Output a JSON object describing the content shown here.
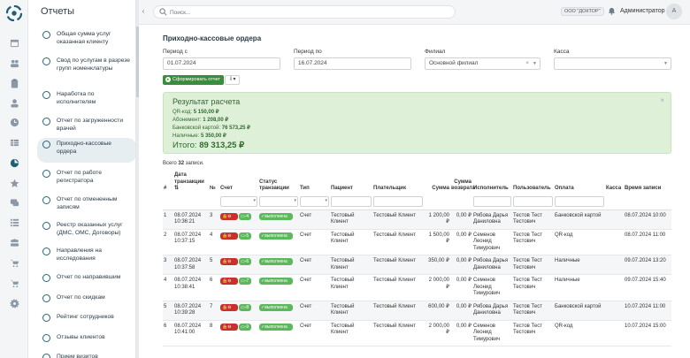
{
  "sidebar": {
    "title": "Отчеты",
    "items": [
      {
        "label": "Общая сумма услуг оказанная клиенту"
      },
      {
        "label": "Свод по услугам в разрезе групп номенклатуры"
      },
      {
        "label": "Наработка по исполнителям"
      },
      {
        "label": "Отчет по загруженности врачей"
      },
      {
        "label": "Приходно-кассовые ордера",
        "active": true
      },
      {
        "label": "Отчет по работе регистратора"
      },
      {
        "label": "Отчет по отмененным записям"
      },
      {
        "label": "Реестр оказанных услуг (ДМС, ОМС, Договоры)"
      },
      {
        "label": "Направления на исследования"
      },
      {
        "label": "Отчет по направившим"
      },
      {
        "label": "Отчет по скидкам"
      },
      {
        "label": "Рейтинг сотрудников"
      },
      {
        "label": "Отзывы клиентов"
      },
      {
        "label": "Прием визитов"
      }
    ]
  },
  "rail_icons": [
    "calendar-icon",
    "users-icon",
    "clipboard-icon",
    "user-icon",
    "clock-icon",
    "table-icon",
    "reports-icon",
    "star-icon",
    "chat-icon",
    "list-icon",
    "group-icon",
    "cart-icon",
    "cart-icon",
    "gear-icon"
  ],
  "header": {
    "search_placeholder": "Поиск...",
    "org": "ООО \"ДОКТОР\"",
    "user": "Администратор",
    "avatar": "А"
  },
  "page": {
    "title": "Приходно-кассовые ордера",
    "filters": {
      "period_from_label": "Период с",
      "period_from": "01.07.2024",
      "period_to_label": "Период по",
      "period_to": "16.07.2024",
      "branch_label": "Филиал",
      "branch": "Основной филиал",
      "cashbox_label": "Касса",
      "cashbox": ""
    },
    "form_button": "Сформировать отчет",
    "download_button": "⇩▾"
  },
  "result": {
    "title": "Результат расчета",
    "lines": [
      {
        "label": "QR-код:",
        "value": "5 150,00 ₽"
      },
      {
        "label": "Абонемент:",
        "value": "1 208,00 ₽"
      },
      {
        "label": "Банковской картой:",
        "value": "76 573,25 ₽"
      },
      {
        "label": "Наличные:",
        "value": "5 350,00 ₽"
      }
    ],
    "total_label": "Итого:",
    "total_value": "89 313,25 ₽",
    "close": "×"
  },
  "count": {
    "prefix": "Всего",
    "value": "32",
    "suffix": "записи."
  },
  "table": {
    "headers": [
      "#",
      "Дата транзакции ⇅",
      "№",
      "Счет",
      "Статус транзакции",
      "Тип",
      "Пациент",
      "Плательщик",
      "Сумма",
      "Сумма возврата",
      "Исполнитель",
      "Пользователь",
      "Оплата",
      "Касса",
      "Время записи"
    ],
    "rows": [
      {
        "n": "1",
        "date": "08.07.2024 10:36:21",
        "num": "3",
        "b1": "🔒⊖",
        "b2": "▭-4",
        "status": "✓выполнена",
        "type": "Счет",
        "patient": "Тестовый Клиент",
        "payer": "Тестовый Клиент",
        "sum": "1 200,00 ₽",
        "ret": "0,00 ₽",
        "doctor": "Рябова Дарья Даниловна",
        "user": "Тестов Тест Тестович",
        "pay": "Банковской картой",
        "cash": "",
        "time": "08.07.2024 10:00"
      },
      {
        "n": "2",
        "date": "08.07.2024 10:37:15",
        "num": "4",
        "b1": "🔒⊖",
        "b2": "▭-5",
        "status": "✓выполнена",
        "type": "Счет",
        "patient": "Тестовый Клиент",
        "payer": "Тестовый Клиент",
        "sum": "1 500,00 ₽",
        "ret": "0,00 ₽",
        "doctor": "Семенов Леонид Тимурович",
        "user": "Тестов Тест Тестович",
        "pay": "QR-код",
        "cash": "",
        "time": "08.07.2024 11:00"
      },
      {
        "n": "3",
        "date": "08.07.2024 10:37:58",
        "num": "5",
        "b1": "🔒⊖",
        "b2": "▭-6",
        "status": "✓выполнена",
        "type": "Счет",
        "patient": "Тестовый Клиент",
        "payer": "Тестовый Клиент",
        "sum": "350,00 ₽",
        "ret": "0,00 ₽",
        "doctor": "Рябова Дарья Даниловна",
        "user": "Тестов Тест Тестович",
        "pay": "Наличные",
        "cash": "",
        "time": "09.07.2024 13:20"
      },
      {
        "n": "4",
        "date": "08.07.2024 10:38:41",
        "num": "6",
        "b1": "🔒⊖",
        "b2": "▭-7",
        "status": "✓выполнена",
        "type": "Счет",
        "patient": "Тестовый Клиент",
        "payer": "Тестовый Клиент",
        "sum": "2 000,00 ₽",
        "ret": "0,00 ₽",
        "doctor": "Семенов Леонид Тимурович",
        "user": "Тестов Тест Тестович",
        "pay": "Наличные",
        "cash": "",
        "time": "09.07.2024 15:40"
      },
      {
        "n": "5",
        "date": "08.07.2024 10:39:28",
        "num": "7",
        "b1": "🔒⊖",
        "b2": "▭-8",
        "status": "✓выполнена",
        "type": "Счет",
        "patient": "Тестовый Клиент",
        "payer": "Тестовый Клиент",
        "sum": "600,00 ₽",
        "ret": "0,00 ₽",
        "doctor": "Рябова Дарья Даниловна",
        "user": "Тестов Тест Тестович",
        "pay": "Банковской картой",
        "cash": "",
        "time": "10.07.2024 11:00"
      },
      {
        "n": "6",
        "date": "08.07.2024 10:41:00",
        "num": "8",
        "b1": "🔒⊖",
        "b2": "▭-9",
        "status": "✓выполнена",
        "type": "Счет",
        "patient": "Тестовый Клиент",
        "payer": "Тестовый Клиент",
        "sum": "2 000,00 ₽",
        "ret": "0,00 ₽",
        "doctor": "Семенов Леонид Тимурович",
        "user": "Тестов Тест Тестович",
        "pay": "QR-код",
        "cash": "",
        "time": "10.07.2024 15:00"
      }
    ]
  },
  "colors": {
    "accent": "#1f5f74",
    "success": "#5cb85c",
    "danger": "#c9302c",
    "result_bg": "#dff0d8"
  }
}
